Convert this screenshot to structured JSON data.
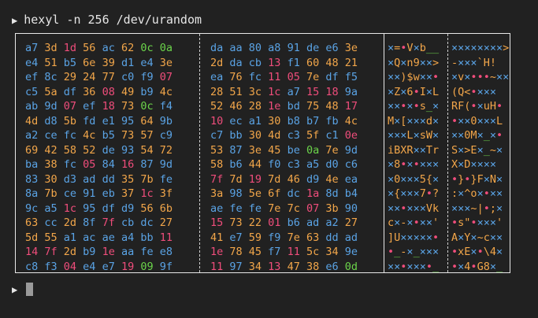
{
  "terminal": {
    "prompt_symbol": "▶",
    "command": "hexyl -n 256 /dev/urandom"
  },
  "colors": {
    "ascii": "#f2a64a",
    "nonascii": "#ef4d7b",
    "null": "#6a6a6a",
    "whitespace": "#6bd44a",
    "printable": "#5aa3e5"
  },
  "hex_left": [
    "a7 3d 1d 56 ac 62 0c 0a",
    "e4 51 b5 6e 39 d1 e4 3e",
    "ef 8c 29 24 77 c0 f9 07",
    "c5 5a df 36 08 49 b9 4c",
    "ab 9d 07 ef 18 73 0c f4",
    "4d d8 5b fd e1 95 64 9b",
    "a2 ce fc 4c b5 73 57 c9",
    "69 42 58 52 de 93 54 72",
    "ba 38 fc 05 84 16 87 9d",
    "83 30 d3 ad dd 35 7b fe",
    "8a 7b ce 91 eb 37 1c 3f",
    "9c a5 1c 95 df d9 56 6b",
    "63 cc 2d 8f 7f cb dc 27",
    "5d 55 a1 ac ae a4 bb 11",
    "14 7f 2d b9 1e aa fe e8",
    "c8 f3 04 e4 e7 19 09 9f"
  ],
  "hex_right": [
    "da aa 80 a8 91 de e6 3e",
    "2d da cb 13 f1 60 48 21",
    "ea 76 fc 11 05 7e df f5",
    "28 51 3c 1c a7 15 18 9a",
    "52 46 28 1e bd 75 48 17",
    "10 ec a1 30 b8 b7 fb 4c",
    "c7 bb 30 4d c3 5f c1 0e",
    "53 87 3e 45 be 0a 7e 9d",
    "58 b6 44 f0 c3 a5 d0 c6",
    "7f 7d 19 7d 46 d9 4e ea",
    "3a 98 5e 6f dc 1a 8d b4",
    "ae fe fe 7e 7c 07 3b 90",
    "15 73 22 01 b6 ad a2 27",
    "41 e7 59 f9 7e 63 dd ad",
    "1e 78 45 f7 11 5c 34 9e",
    "11 97 34 13 47 38 e6 0d"
  ],
  "ascii_left": [
    "×=•V×b__",
    "×Q×n9××>",
    "××)$w××•",
    "×Z×6•I×L",
    "××•×•s_×",
    "M×[×××d×",
    "×××L×sW×",
    "iBXR××Tr",
    "×8•×•×××",
    "×0×××5{×",
    "×{×××7•?",
    "××•×××Vk",
    "c×-×•××'",
    "]U×××××•",
    "•_-×_×××",
    "××•×××•_"
  ],
  "ascii_right": [
    "××××××××>",
    "-×××`H!",
    "×v×•••~××",
    "(Q<•×××",
    "RF(•×uH•",
    "•××0×××L",
    "××0M×_×•",
    "S×>E×_~×",
    "X×D××××",
    "•}•}F×N×",
    ":×^o×•××",
    "×××~|•;×",
    "•s\"•×××'",
    "A×Y×~c××",
    "•xE×•\\4×",
    "•×4•G8×_"
  ]
}
